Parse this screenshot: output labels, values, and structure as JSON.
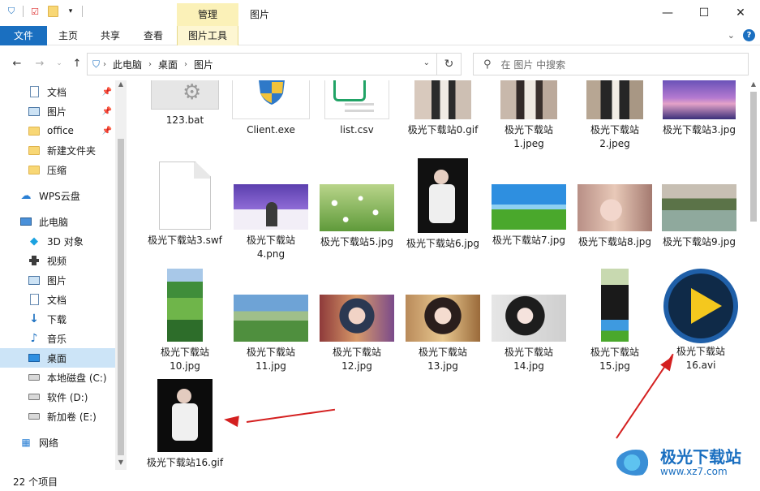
{
  "window": {
    "title": "图片",
    "context_tab": "管理"
  },
  "ribbon": {
    "tabs": [
      "文件",
      "主页",
      "共享",
      "查看",
      "图片工具"
    ]
  },
  "address": {
    "crumbs": [
      "此电脑",
      "桌面",
      "图片"
    ],
    "search_placeholder": "在 图片 中搜索"
  },
  "sidebar": {
    "items": [
      {
        "label": "文档",
        "icon": "document-icon",
        "pinned": true
      },
      {
        "label": "图片",
        "icon": "pictures-icon",
        "pinned": true
      },
      {
        "label": "office",
        "icon": "folder-icon",
        "pinned": true
      },
      {
        "label": "新建文件夹",
        "icon": "folder-icon",
        "pinned": false
      },
      {
        "label": "压缩",
        "icon": "folder-icon",
        "pinned": false
      },
      {
        "label": "WPS云盘",
        "icon": "cloud-icon",
        "pinned": false
      },
      {
        "label": "此电脑",
        "icon": "computer-icon",
        "pinned": false
      },
      {
        "label": "3D 对象",
        "icon": "3d-objects-icon",
        "pinned": false
      },
      {
        "label": "视频",
        "icon": "video-icon",
        "pinned": false
      },
      {
        "label": "图片",
        "icon": "pictures-icon",
        "pinned": false
      },
      {
        "label": "文档",
        "icon": "document-icon",
        "pinned": false
      },
      {
        "label": "下载",
        "icon": "download-icon",
        "pinned": false
      },
      {
        "label": "音乐",
        "icon": "music-icon",
        "pinned": false
      },
      {
        "label": "桌面",
        "icon": "desktop-icon",
        "pinned": false,
        "selected": true
      },
      {
        "label": "本地磁盘 (C:)",
        "icon": "drive-icon",
        "pinned": false
      },
      {
        "label": "软件 (D:)",
        "icon": "drive-icon",
        "pinned": false
      },
      {
        "label": "新加卷 (E:)",
        "icon": "drive-icon",
        "pinned": false
      },
      {
        "label": "网络",
        "icon": "network-icon",
        "pinned": false
      }
    ]
  },
  "files": [
    {
      "name": "123.bat",
      "type": "bat"
    },
    {
      "name": "Client.exe",
      "type": "exe"
    },
    {
      "name": "list.csv",
      "type": "csv"
    },
    {
      "name": "极光下载站0.gif",
      "type": "portrait"
    },
    {
      "name": "极光下载站\n1.jpeg",
      "type": "portrait"
    },
    {
      "name": "极光下载站\n2.jpeg",
      "type": "portrait"
    },
    {
      "name": "极光下载站3.jpg",
      "type": "sunset"
    },
    {
      "name": "极光下载站3.swf",
      "type": "blank"
    },
    {
      "name": "极光下载站\n4.png",
      "type": "purple"
    },
    {
      "name": "极光下载站5.jpg",
      "type": "flowers"
    },
    {
      "name": "极光下载站6.jpg",
      "type": "tallphoto"
    },
    {
      "name": "极光下载站7.jpg",
      "type": "field"
    },
    {
      "name": "极光下载站8.jpg",
      "type": "face"
    },
    {
      "name": "极光下载站9.jpg",
      "type": "lake"
    },
    {
      "name": "极光下载站\n10.jpg",
      "type": "hills"
    },
    {
      "name": "极光下载站\n11.jpg",
      "type": "meadow"
    },
    {
      "name": "极光下载站\n12.jpg",
      "type": "anime"
    },
    {
      "name": "极光下载站\n13.jpg",
      "type": "face2"
    },
    {
      "name": "极光下载站\n14.jpg",
      "type": "face3"
    },
    {
      "name": "极光下载站\n15.jpg",
      "type": "strip"
    },
    {
      "name": "极光下载站\n16.avi",
      "type": "player"
    },
    {
      "name": "极光下载站16.gif",
      "type": "tallphoto"
    }
  ],
  "status": {
    "count": "22 个项目"
  },
  "watermark": {
    "name": "极光下载站",
    "url": "www.xz7.com"
  }
}
